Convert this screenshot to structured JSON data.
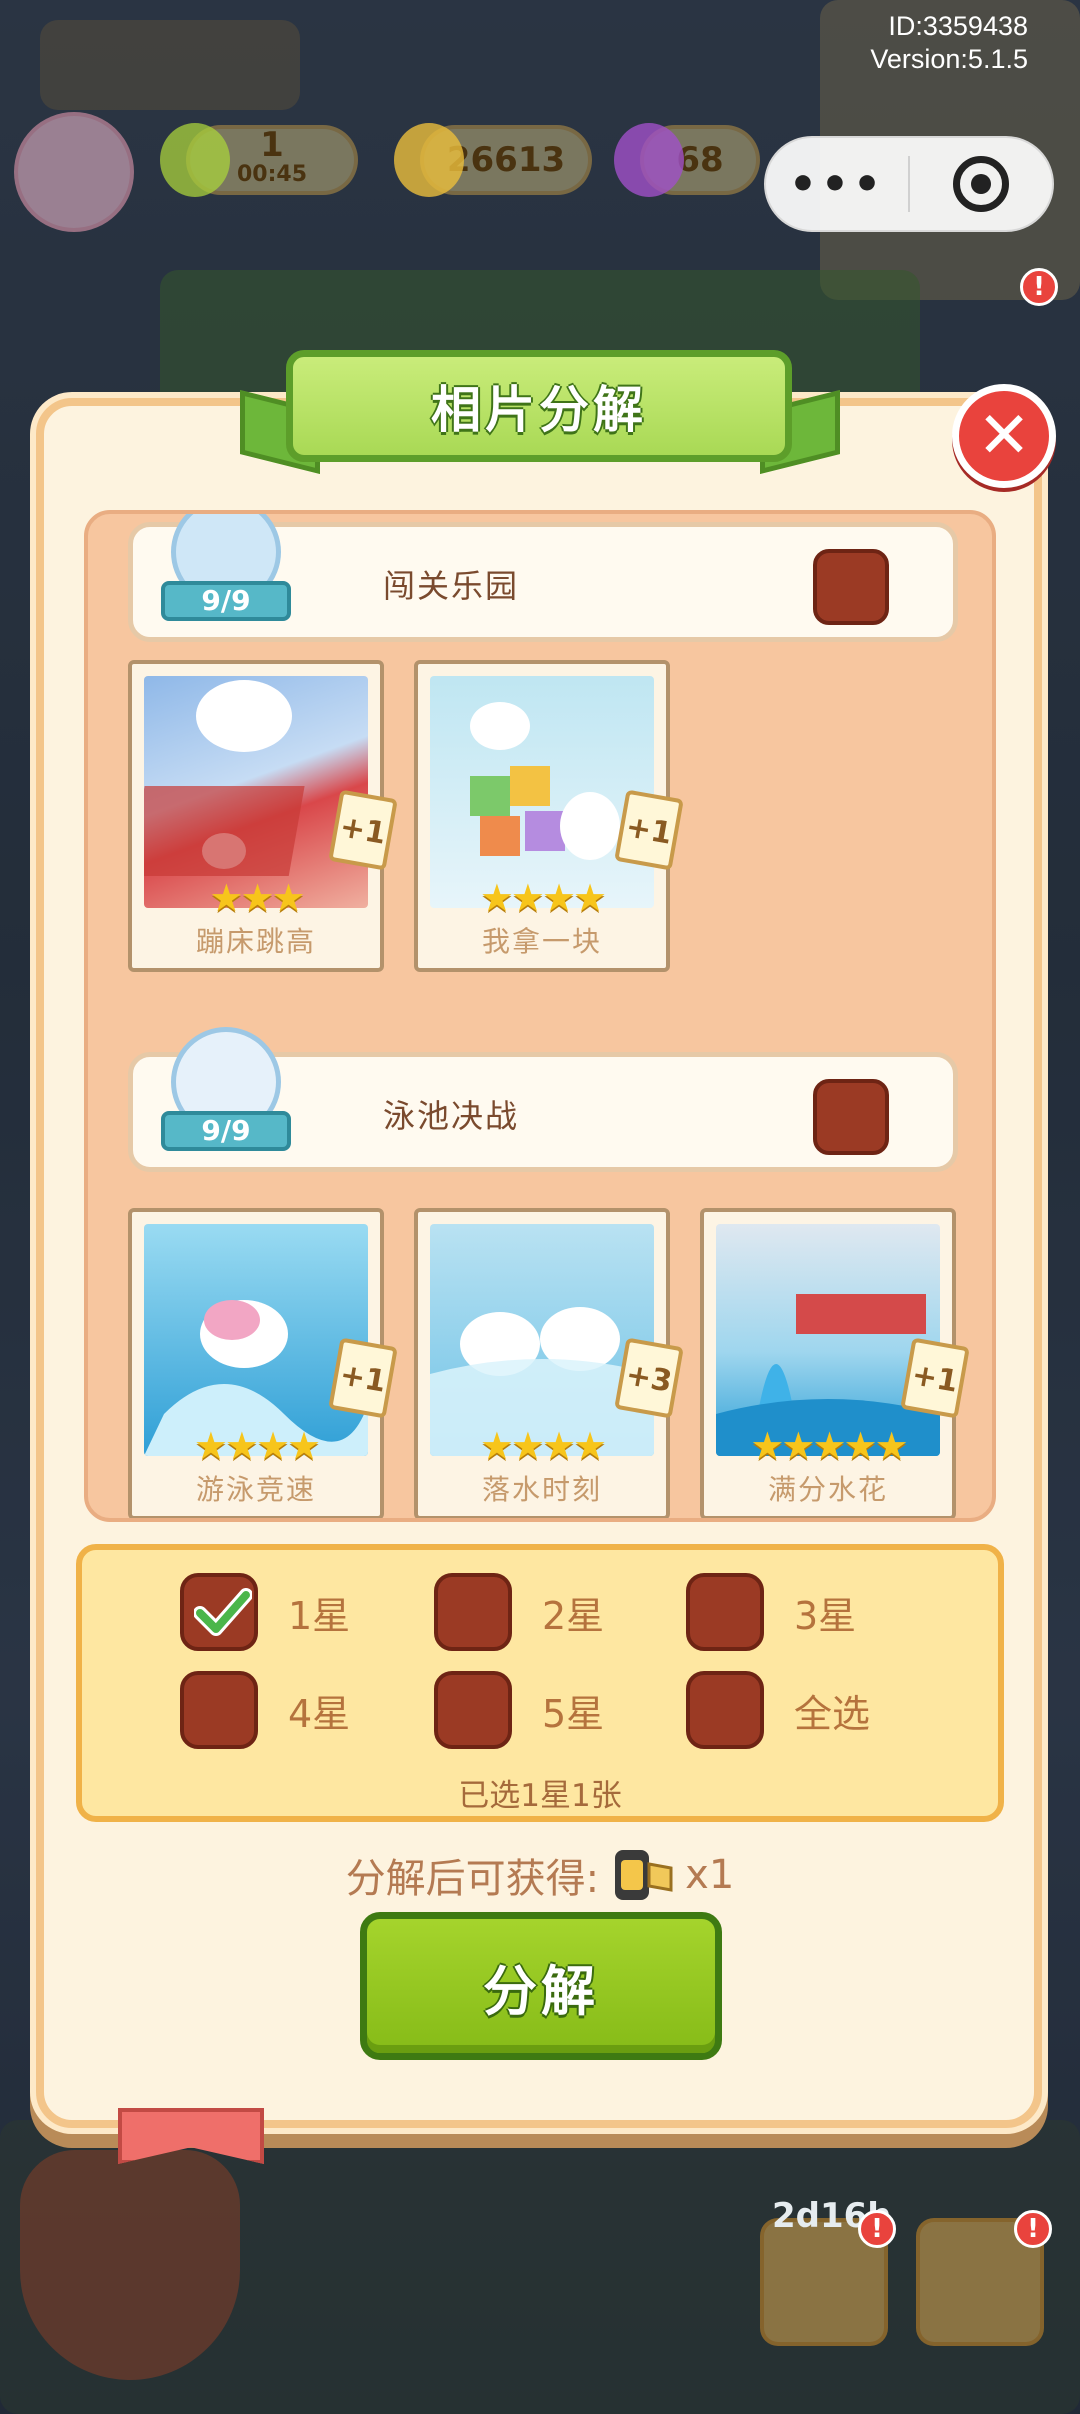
{
  "top_info": {
    "id_text": "ID:3359438",
    "version_text": "Version:5.1.5"
  },
  "resources": [
    {
      "name": "energy",
      "value": "1",
      "sub": "00:45"
    },
    {
      "name": "coins",
      "value": "26613"
    },
    {
      "name": "gems",
      "value": "68"
    }
  ],
  "capsule": {
    "more_label": "•••",
    "close_label": "◉"
  },
  "modal": {
    "title": "相片分解",
    "close_label": "✕"
  },
  "groups": [
    {
      "name": "闯关乐园",
      "count": "9/9",
      "cards": [
        {
          "title": "蹦床跳高",
          "stars": 3,
          "plus": "+1"
        },
        {
          "title": "我拿一块",
          "stars": 4,
          "plus": "+1"
        }
      ]
    },
    {
      "name": "泳池决战",
      "count": "9/9",
      "cards": [
        {
          "title": "游泳竞速",
          "stars": 4,
          "plus": "+1"
        },
        {
          "title": "落水时刻",
          "stars": 4,
          "plus": "+3"
        },
        {
          "title": "满分水花",
          "stars": 5,
          "plus": "+1"
        }
      ]
    }
  ],
  "star_filter": {
    "options": [
      {
        "label": "1星",
        "checked": true
      },
      {
        "label": "2星",
        "checked": false
      },
      {
        "label": "3星",
        "checked": false
      },
      {
        "label": "4星",
        "checked": false
      },
      {
        "label": "5星",
        "checked": false
      },
      {
        "label": "全选",
        "checked": false
      }
    ],
    "summary": "已选1星1张"
  },
  "reward": {
    "label": "分解后可获得:",
    "amount": "x1"
  },
  "decompose_button": "分解",
  "bottom_badges": {
    "timer": "2d16h"
  },
  "colors": {
    "title_green": "#a9d955",
    "panel_yellow": "#fee7a1",
    "checkbox_brown": "#9b3a24",
    "button_green": "#86bb18",
    "close_red": "#e9433d",
    "star_gold": "#f7c51b"
  }
}
